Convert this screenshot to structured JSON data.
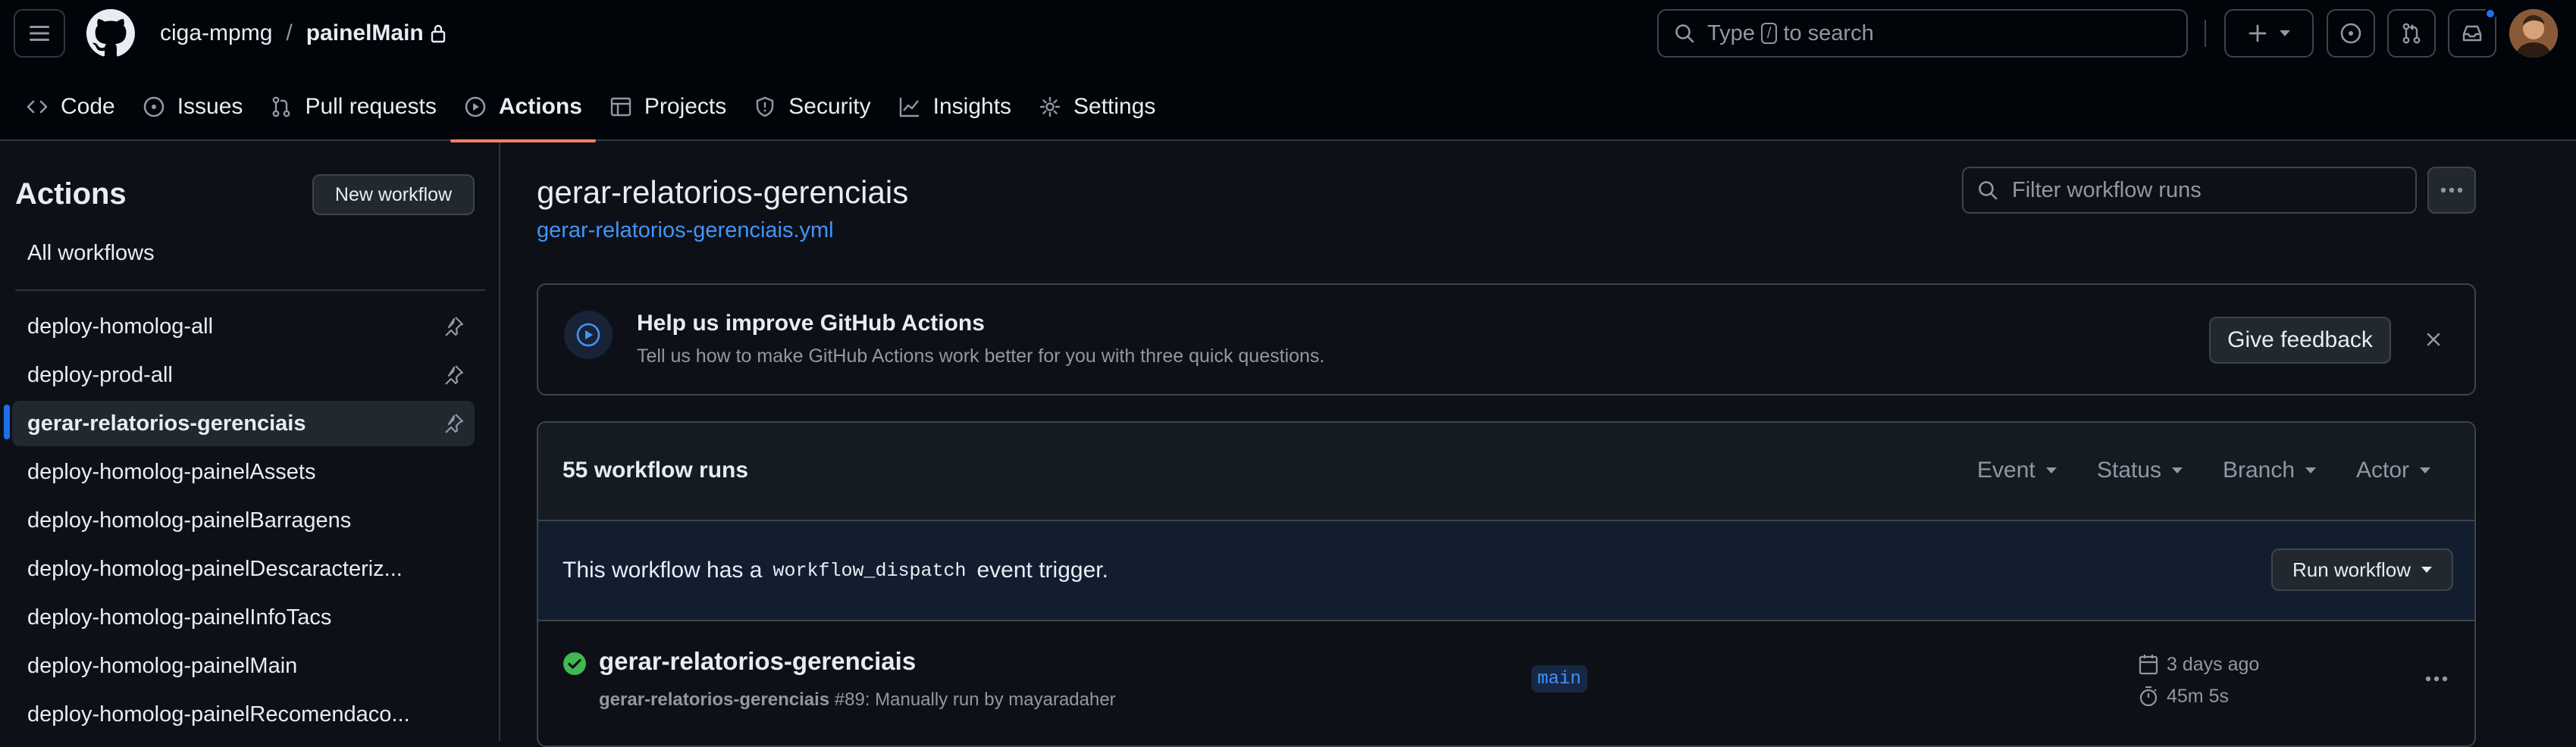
{
  "header": {
    "owner": "ciga-mpmg",
    "separator": "/",
    "repo": "painelMain",
    "search_prefix": "Type",
    "search_key": "/",
    "search_suffix": "to search"
  },
  "nav": {
    "tabs": [
      {
        "label": "Code",
        "icon": "code-icon"
      },
      {
        "label": "Issues",
        "icon": "issue-opened-icon"
      },
      {
        "label": "Pull requests",
        "icon": "git-pull-request-icon"
      },
      {
        "label": "Actions",
        "icon": "play-icon",
        "active": true
      },
      {
        "label": "Projects",
        "icon": "table-icon"
      },
      {
        "label": "Security",
        "icon": "shield-icon"
      },
      {
        "label": "Insights",
        "icon": "graph-icon"
      },
      {
        "label": "Settings",
        "icon": "gear-icon"
      }
    ]
  },
  "sidebar": {
    "title": "Actions",
    "new_workflow": "New workflow",
    "all_workflows": "All workflows",
    "items": [
      {
        "label": "deploy-homolog-all",
        "pinned": true
      },
      {
        "label": "deploy-prod-all",
        "pinned": true
      },
      {
        "label": "gerar-relatorios-gerenciais",
        "pinned": true,
        "active": true
      },
      {
        "label": "deploy-homolog-painelAssets"
      },
      {
        "label": "deploy-homolog-painelBarragens"
      },
      {
        "label": "deploy-homolog-painelDescaracteriz..."
      },
      {
        "label": "deploy-homolog-painelInfoTacs"
      },
      {
        "label": "deploy-homolog-painelMain"
      },
      {
        "label": "deploy-homolog-painelRecomendaco..."
      }
    ]
  },
  "main": {
    "title": "gerar-relatorios-gerenciais",
    "file": "gerar-relatorios-gerenciais.yml",
    "filter_placeholder": "Filter workflow runs",
    "feedback": {
      "title": "Help us improve GitHub Actions",
      "description": "Tell us how to make GitHub Actions work better for you with three quick questions.",
      "button": "Give feedback"
    },
    "runs": {
      "count_label": "55 workflow runs",
      "filters": [
        "Event",
        "Status",
        "Branch",
        "Actor"
      ],
      "dispatch_before": "This workflow has a",
      "dispatch_code": "workflow_dispatch",
      "dispatch_after": "event trigger.",
      "run_button": "Run workflow",
      "rows": [
        {
          "title": "gerar-relatorios-gerenciais",
          "workflow": "gerar-relatorios-gerenciais",
          "meta_rest": "#89: Manually run by mayaradaher",
          "branch": "main",
          "date": "3 days ago",
          "duration": "45m 5s",
          "status": "success"
        }
      ]
    }
  },
  "colors": {
    "accent": "#1f6feb",
    "link": "#4493f8",
    "success": "#3fb950",
    "tab_underline": "#f78166"
  }
}
